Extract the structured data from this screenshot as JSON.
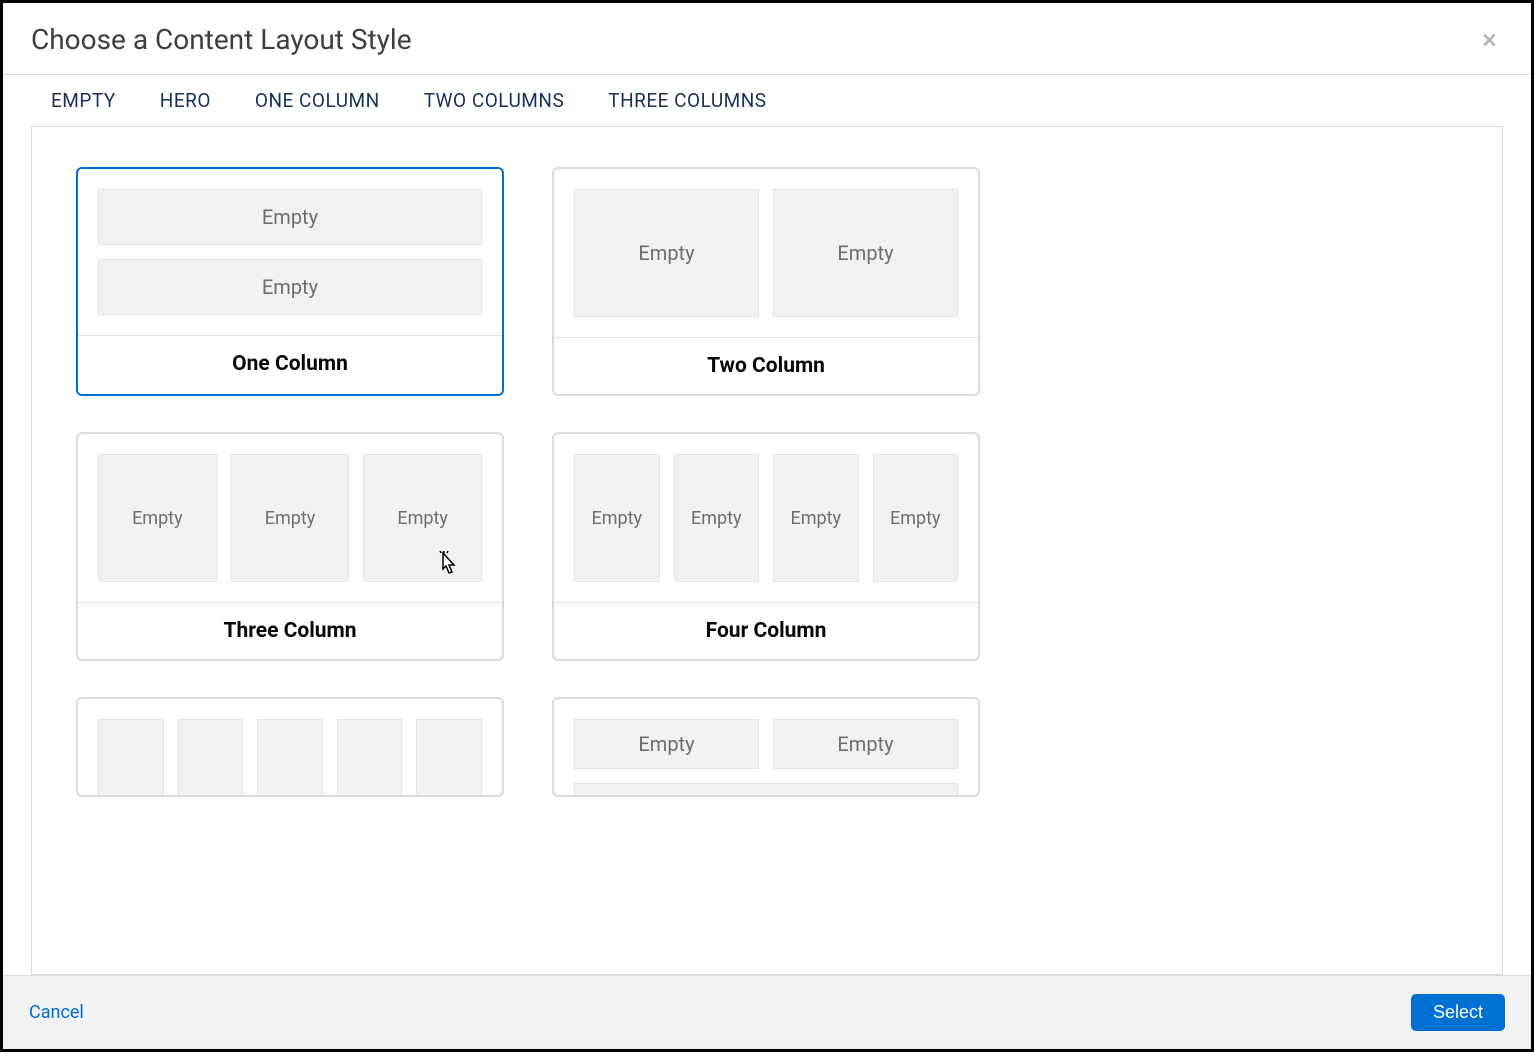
{
  "header": {
    "title": "Choose a Content Layout Style"
  },
  "tabs": [
    "EMPTY",
    "HERO",
    "ONE COLUMN",
    "TWO COLUMNS",
    "THREE COLUMNS"
  ],
  "cards": {
    "one_column": {
      "label": "One Column",
      "boxes": [
        "Empty",
        "Empty"
      ]
    },
    "two_column": {
      "label": "Two Column",
      "boxes": [
        "Empty",
        "Empty"
      ]
    },
    "three_column": {
      "label": "Three Column",
      "boxes": [
        "Empty",
        "Empty",
        "Empty"
      ]
    },
    "four_column": {
      "label": "Four Column",
      "boxes": [
        "Empty",
        "Empty",
        "Empty",
        "Empty"
      ]
    },
    "five_column": {
      "boxes": [
        "",
        "",
        "",
        "",
        ""
      ]
    },
    "mixed": {
      "boxes": [
        "Empty",
        "Empty"
      ]
    }
  },
  "footer": {
    "cancel": "Cancel",
    "select": "Select"
  }
}
